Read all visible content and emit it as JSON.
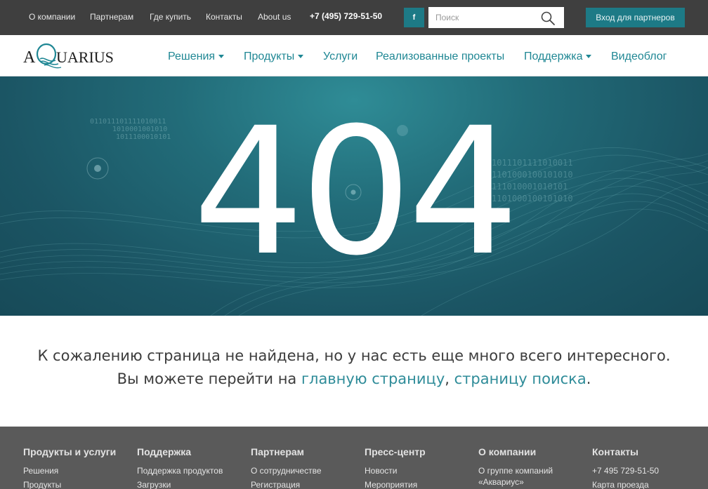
{
  "topbar": {
    "links": [
      "О компании",
      "Партнерам",
      "Где купить",
      "Контакты",
      "About us"
    ],
    "phone": "+7 (495) 729-51-50",
    "social_label": "f",
    "search_placeholder": "Поиск",
    "partner_login": "Вход для партнеров"
  },
  "header": {
    "logo_text": "AQUARIUS",
    "nav": [
      {
        "label": "Решения",
        "dropdown": true
      },
      {
        "label": "Продукты",
        "dropdown": true
      },
      {
        "label": "Услуги",
        "dropdown": false
      },
      {
        "label": "Реализованные проекты",
        "dropdown": false
      },
      {
        "label": "Поддержка",
        "dropdown": true
      },
      {
        "label": "Видеоблог",
        "dropdown": false
      }
    ]
  },
  "hero": {
    "code": "404",
    "binary": {
      "left": [
        "011011101111010011",
        "1010001001010",
        "1011100010101"
      ],
      "right": [
        "1011101111010011",
        "1101000100101010",
        "111010001010101",
        "1101000100101010"
      ]
    }
  },
  "message": {
    "line1": "К сожалению страница не найдена, но у нас есть еще много всего интересного.",
    "line2_prefix": "Вы можете перейти на ",
    "link_home": "главную страницу",
    "separator": ", ",
    "link_search": "страницу поиска",
    "suffix": "."
  },
  "footer": {
    "columns": [
      {
        "heading": "Продукты и услуги",
        "links": [
          "Решения",
          "Продукты"
        ]
      },
      {
        "heading": "Поддержка",
        "links": [
          "Поддержка продуктов",
          "Загрузки"
        ]
      },
      {
        "heading": "Партнерам",
        "links": [
          "О сотрудничестве",
          "Регистрация"
        ]
      },
      {
        "heading": "Пресс-центр",
        "links": [
          "Новости",
          "Мероприятия"
        ]
      },
      {
        "heading": "О компании",
        "links": [
          "О группе компаний «Аквариус»"
        ]
      },
      {
        "heading": "Контакты",
        "links": [
          "+7 495 729-51-50",
          "Карта проезда"
        ]
      }
    ]
  },
  "colors": {
    "accent": "#1f8794",
    "topbar": "#3f3f3f",
    "footer": "#5a5a5a",
    "hero_dark": "#174a58",
    "hero_light": "#2f8c96"
  },
  "icons": {
    "search": "search-icon",
    "social": "facebook-icon",
    "dropdown": "caret-down-icon"
  }
}
